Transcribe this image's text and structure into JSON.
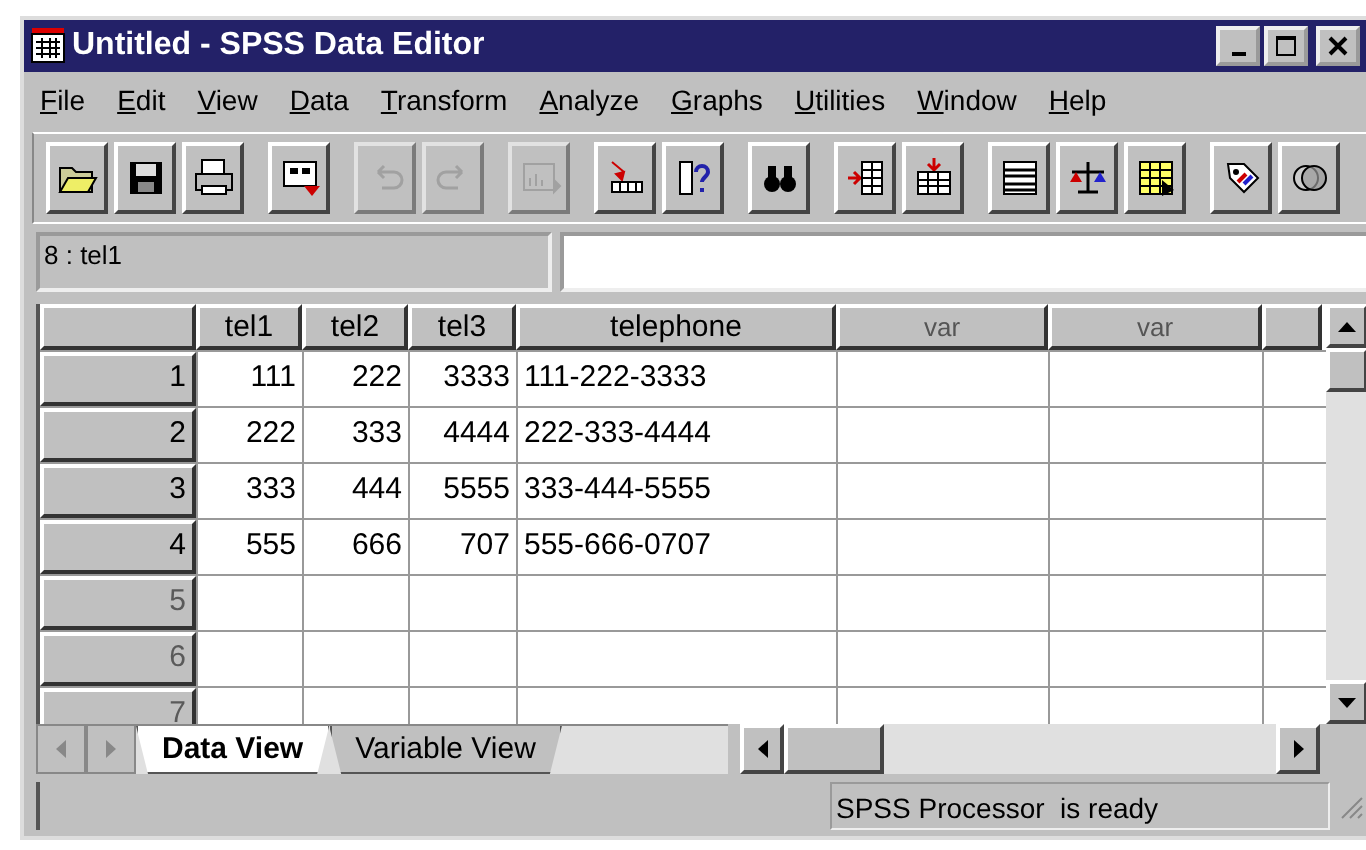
{
  "window": {
    "title": "Untitled - SPSS Data Editor"
  },
  "menu": [
    "File",
    "Edit",
    "View",
    "Data",
    "Transform",
    "Analyze",
    "Graphs",
    "Utilities",
    "Window",
    "Help"
  ],
  "toolbar": [
    [
      {
        "kind": "open",
        "disabled": false
      },
      {
        "kind": "save",
        "disabled": false
      },
      {
        "kind": "print",
        "disabled": false
      }
    ],
    [
      {
        "kind": "recall",
        "disabled": false
      }
    ],
    [
      {
        "kind": "undo",
        "disabled": true
      },
      {
        "kind": "redo",
        "disabled": true
      }
    ],
    [
      {
        "kind": "chart",
        "disabled": true
      }
    ],
    [
      {
        "kind": "gotocase",
        "disabled": false
      },
      {
        "kind": "varinfo",
        "disabled": false
      }
    ],
    [
      {
        "kind": "find",
        "disabled": false
      }
    ],
    [
      {
        "kind": "insertcase",
        "disabled": false
      },
      {
        "kind": "insertvar",
        "disabled": false
      }
    ],
    [
      {
        "kind": "split",
        "disabled": false
      },
      {
        "kind": "weight",
        "disabled": false
      },
      {
        "kind": "select",
        "disabled": false
      }
    ],
    [
      {
        "kind": "labels",
        "disabled": false
      },
      {
        "kind": "sets",
        "disabled": false
      }
    ]
  ],
  "cell_ref": "8 : tel1",
  "table": {
    "columns": [
      {
        "label": "tel1",
        "disabled": false,
        "kind": "numeric"
      },
      {
        "label": "tel2",
        "disabled": false,
        "kind": "numeric"
      },
      {
        "label": "tel3",
        "disabled": false,
        "kind": "numeric"
      },
      {
        "label": "telephone",
        "disabled": false,
        "kind": "string"
      },
      {
        "label": "var",
        "disabled": true
      },
      {
        "label": "var",
        "disabled": true
      }
    ],
    "rows": [
      {
        "number": "1",
        "disabled": false,
        "cells": [
          "111",
          "222",
          "3333",
          "111-222-3333"
        ]
      },
      {
        "number": "2",
        "disabled": false,
        "cells": [
          "222",
          "333",
          "4444",
          "222-333-4444"
        ]
      },
      {
        "number": "3",
        "disabled": false,
        "cells": [
          "333",
          "444",
          "5555",
          "333-444-5555"
        ]
      },
      {
        "number": "4",
        "disabled": false,
        "cells": [
          "555",
          "666",
          "707",
          "555-666-0707"
        ]
      },
      {
        "number": "5",
        "disabled": true,
        "cells": []
      },
      {
        "number": "6",
        "disabled": true,
        "cells": []
      },
      {
        "number": "7",
        "disabled": true,
        "cells": []
      }
    ]
  },
  "tabs": [
    {
      "label": "Data View",
      "selected": true
    },
    {
      "label": "Variable View",
      "selected": false
    }
  ],
  "status_bar": "SPSS Processor  is ready"
}
